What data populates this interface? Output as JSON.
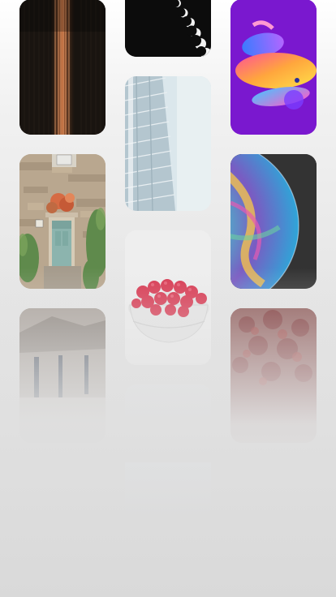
{
  "wallpapers": [
    {
      "name": "curtain-strings",
      "column": 1,
      "accent": "#c9805a"
    },
    {
      "name": "moon-phases",
      "column": 2,
      "accent": "#ffffff"
    },
    {
      "name": "abstract-3d-shapes",
      "column": 3,
      "accent": "#8a23cf"
    },
    {
      "name": "glass-building",
      "column": 2,
      "accent": "#cfdde4"
    },
    {
      "name": "stone-house-door",
      "column": 1,
      "accent": "#8cb2ac"
    },
    {
      "name": "soap-bubble",
      "column": 3,
      "accent": "#f3b63d"
    },
    {
      "name": "raspberries-bowl",
      "column": 2,
      "accent": "#d8364f"
    },
    {
      "name": "stone-wall",
      "column": 1,
      "accent": "#a9a19a"
    },
    {
      "name": "red-texture",
      "column": 3,
      "accent": "#8c2a2a"
    },
    {
      "name": "faded-gray",
      "column": 2,
      "accent": "#dcdcdc"
    }
  ]
}
